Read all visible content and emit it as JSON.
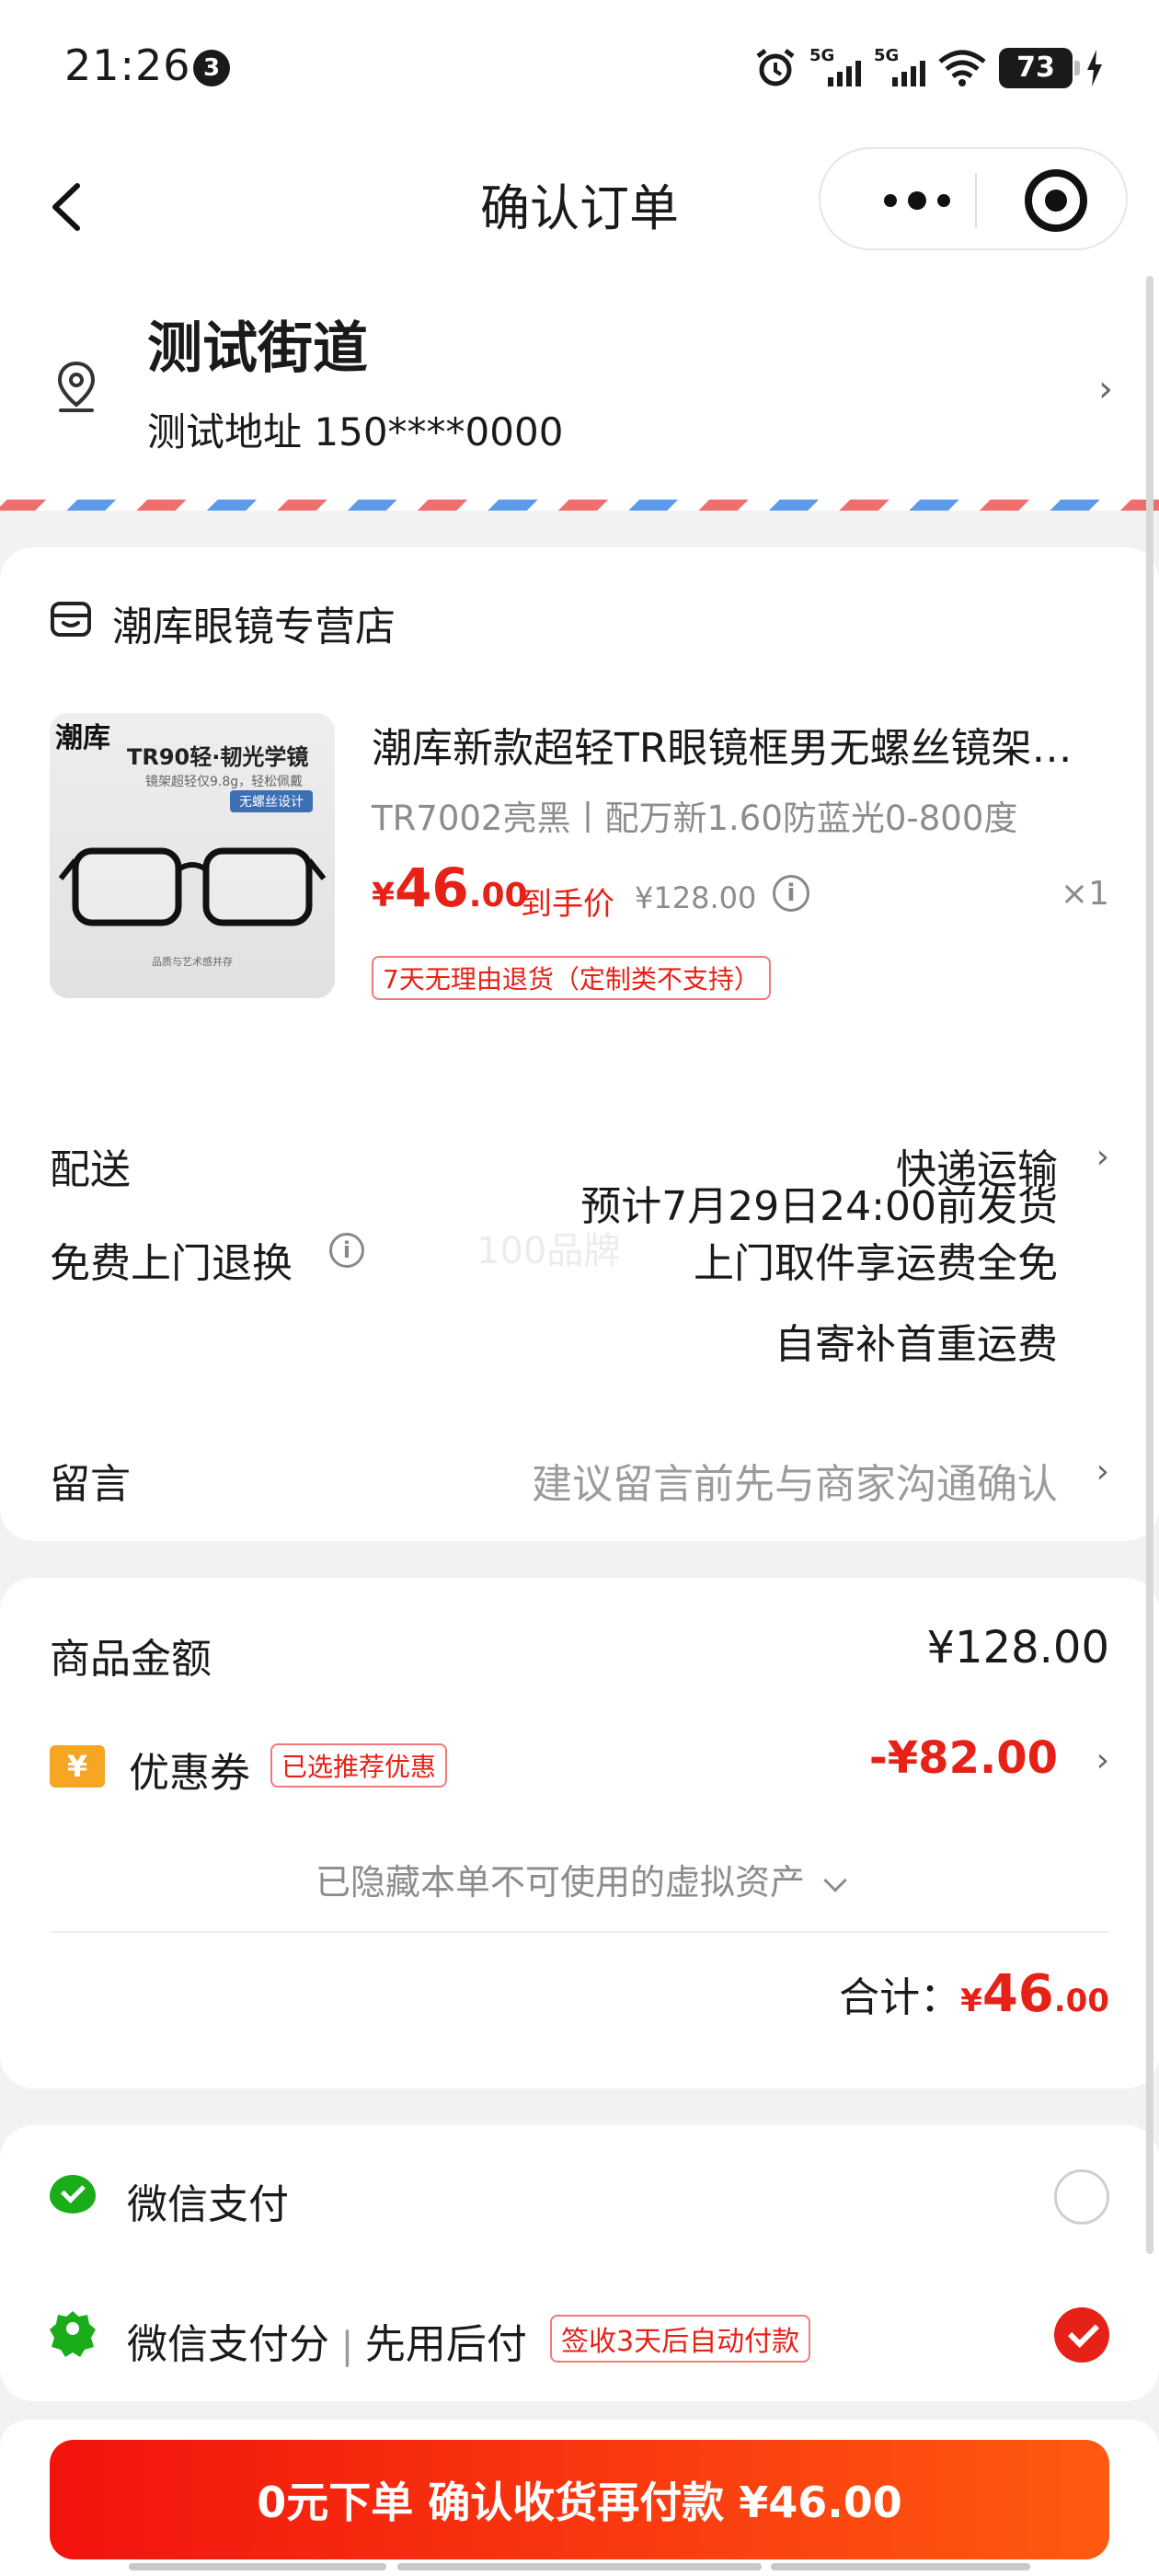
{
  "status_bar": {
    "time": "21:26",
    "notification_count": "3",
    "network_1": "5G",
    "network_2": "5G",
    "battery": "73"
  },
  "nav": {
    "title": "确认订单"
  },
  "address": {
    "name": "测试街道",
    "detail": "测试地址",
    "phone": "150****0000"
  },
  "shop": {
    "name": "潮库眼镜专营店"
  },
  "product": {
    "image_texts": {
      "brand": "潮库",
      "headline": "TR90轻·韧光学镜",
      "subline": "镜架超轻仅9.8g，轻松佩戴",
      "pill": "无螺丝设计",
      "footer": "品质与艺术感并存"
    },
    "title": "潮库新款超轻TR眼镜框男无螺丝镜架女近视眼镜可配度数方框",
    "spec": "TR7002亮黑丨配万新1.60防蓝光0-800度",
    "price_currency": "¥",
    "price_int": "46",
    "price_dec": ".00",
    "final_label": "到手价",
    "original_price": "¥128.00",
    "quantity": "×1",
    "return_tag": "7天无理由退货（定制类不支持）"
  },
  "delivery": {
    "label": "配送",
    "method": "快递运输",
    "estimate": "预计7月29日24:00前发货"
  },
  "free_return": {
    "label": "免费上门退换",
    "watermark": "100品牌",
    "line1": "上门取件享运费全免",
    "line2": "自寄补首重运费"
  },
  "message": {
    "label": "留言",
    "placeholder": "建议留言前先与商家沟通确认"
  },
  "amount": {
    "goods_label": "商品金额",
    "goods_value": "¥128.00",
    "coupon_icon": "¥",
    "coupon_label": "优惠券",
    "coupon_tag": "已选推荐优惠",
    "coupon_value": "-¥82.00",
    "hidden_assets": "已隐藏本单不可使用的虚拟资产",
    "total_label": "合计：",
    "total_currency": "¥",
    "total_int": "46",
    "total_dec": ".00"
  },
  "payment": {
    "wechat_pay": "微信支付",
    "wechat_score": "微信支付分",
    "wechat_score_sub": "先用后付",
    "wechat_score_tag": "签收3天后自动付款",
    "selected": "wechat_score"
  },
  "submit": {
    "label": "0元下单 确认收货再付款 ¥46.00"
  },
  "colors": {
    "accent_red": "#e62117",
    "wechat_green": "#1aad19",
    "coupon_orange": "#f6a623"
  }
}
